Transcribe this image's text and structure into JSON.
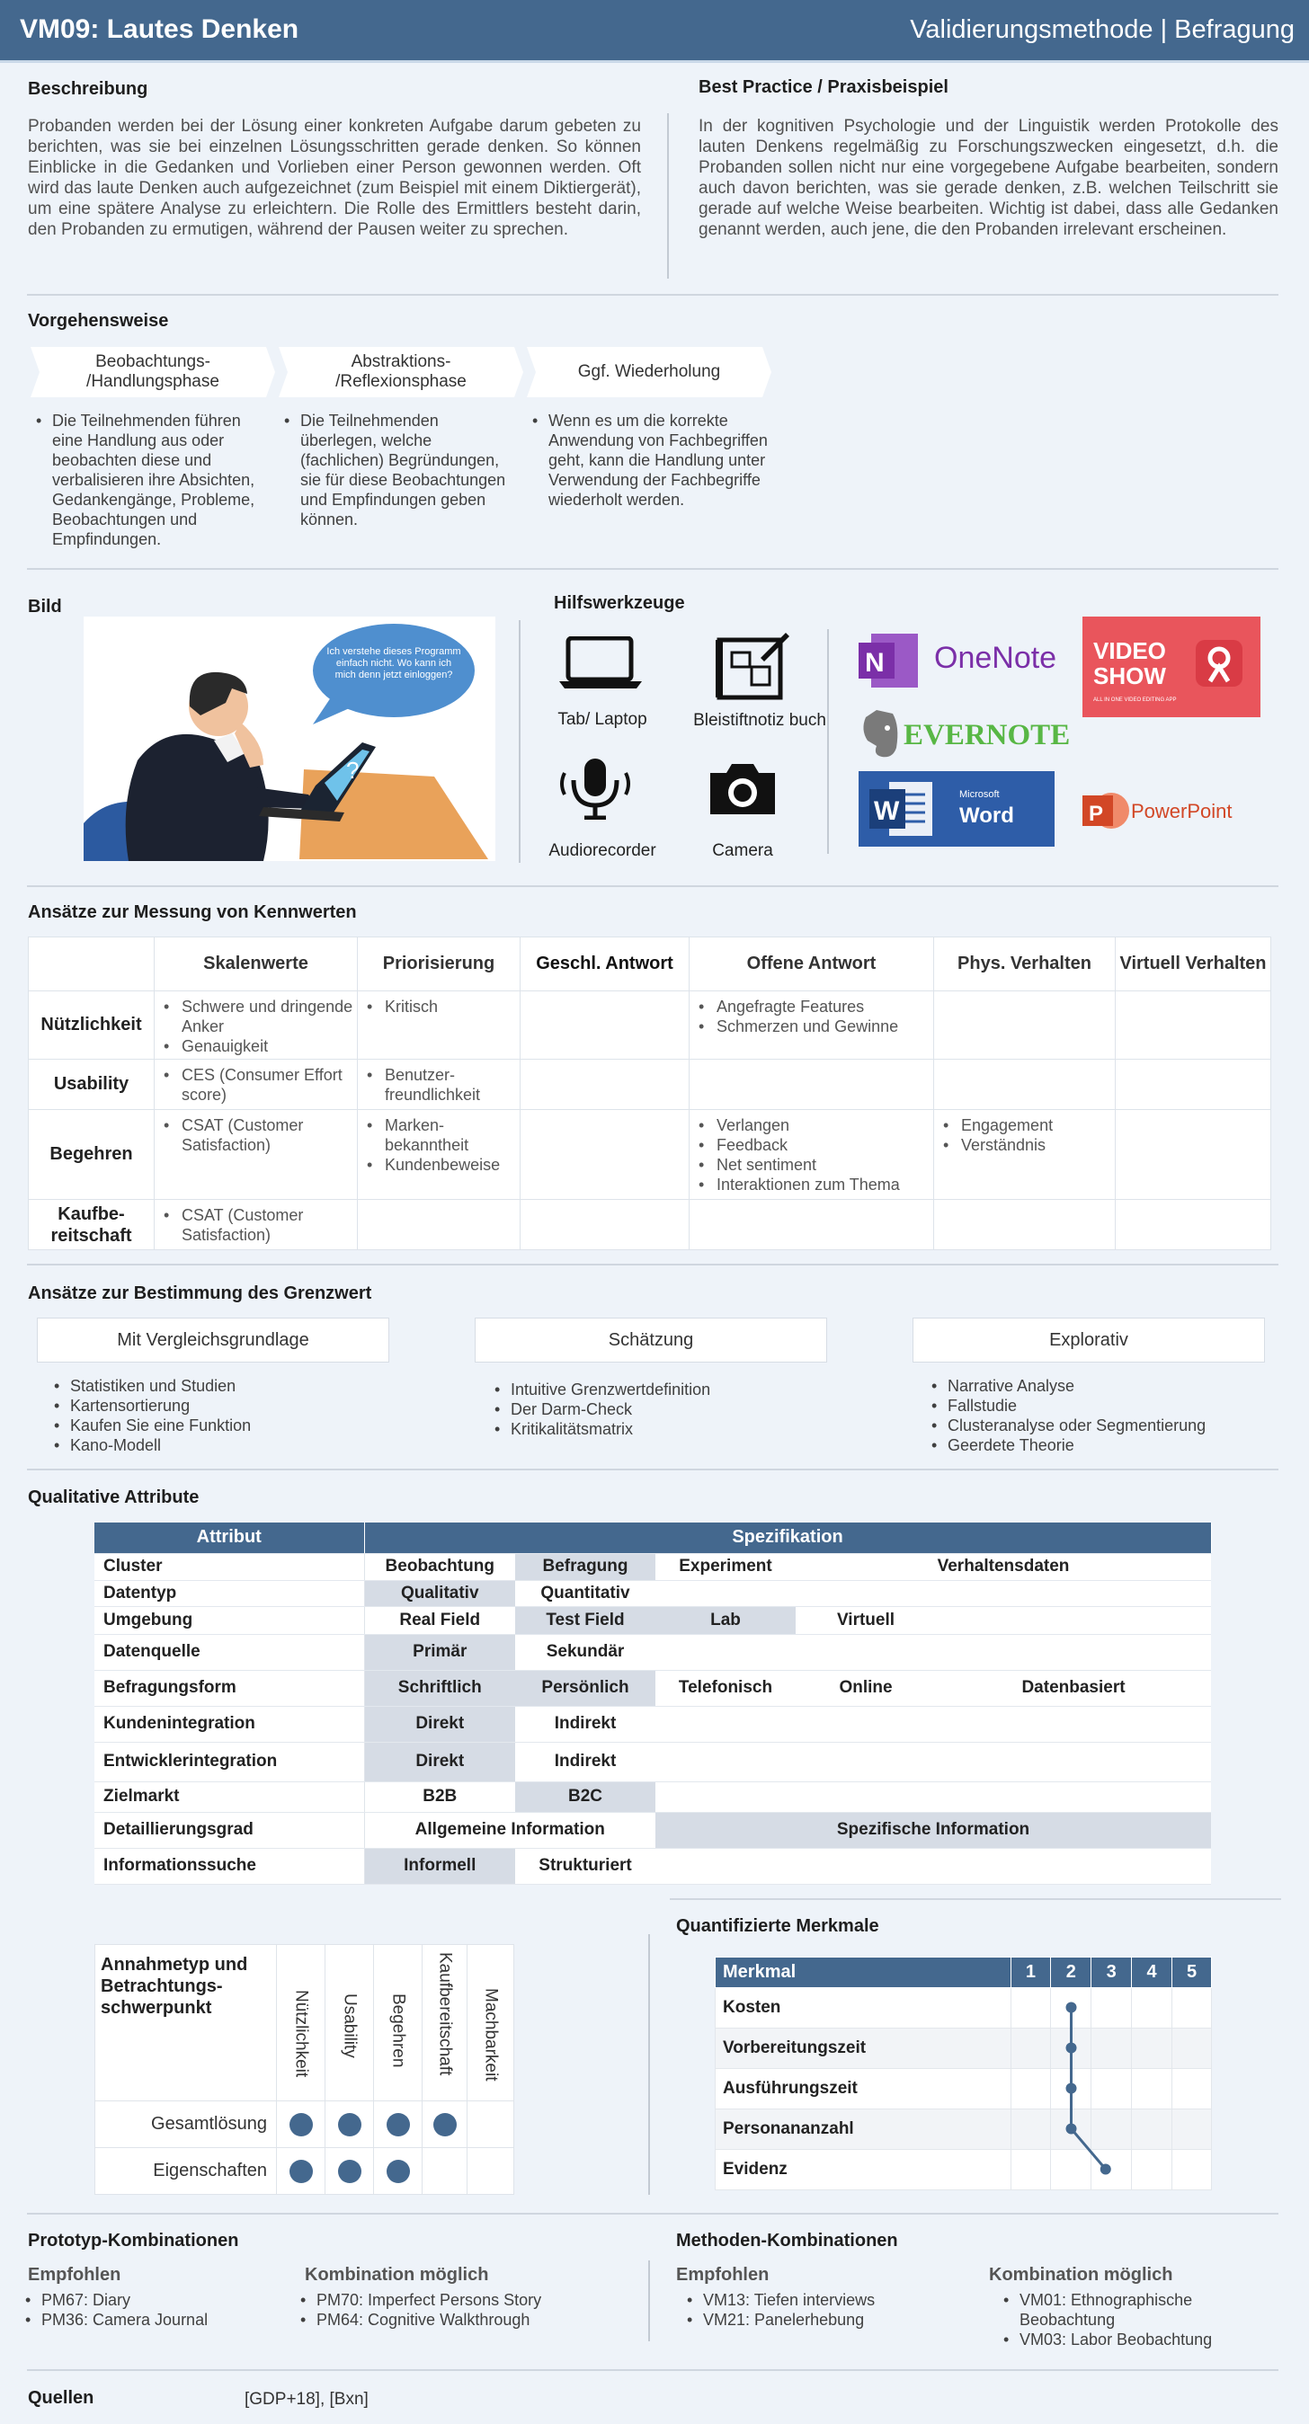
{
  "header": {
    "title": "VM09: Lautes Denken",
    "right": "Validierungsmethode | Befragung"
  },
  "beschreibung": {
    "title": "Beschreibung",
    "text": "Probanden werden bei der Lösung einer konkreten Aufgabe darum gebeten zu berichten, was sie bei einzelnen Lösungsschritten gerade denken. So können Einblicke in die Gedanken und Vorlieben einer Person gewonnen werden. Oft wird das laute Denken auch aufgezeichnet (zum Beispiel mit einem Diktiergerät), um eine spätere Analyse zu erleichtern. Die Rolle des Ermittlers besteht darin, den Probanden zu ermutigen, während der Pausen weiter zu sprechen."
  },
  "best_practice": {
    "title": "Best Practice / Praxisbeispiel",
    "text": "In der kognitiven Psychologie und der Linguistik werden Protokolle des lauten Denkens regelmäßig zu Forschungszwecken eingesetzt, d.h. die Probanden sollen nicht nur eine vorgegebene Aufgabe bearbeiten, sondern auch davon berichten, was sie gerade denken, z.B. welchen Teilschritt sie gerade auf welche Weise bearbeiten. Wichtig ist dabei, dass alle Gedanken genannt werden, auch jene, die den Probanden irrelevant erscheinen."
  },
  "vorgehensweise": {
    "title": "Vorgehensweise",
    "steps": [
      {
        "label": "Beobachtungs- /Handlungsphase",
        "text": "Die Teilnehmenden führen eine Handlung aus oder beobachten diese und verbalisieren ihre Absichten, Gedankengänge, Probleme, Beobachtungen und Empfindungen."
      },
      {
        "label": "Abstraktions- /Reflexionsphase",
        "text": "Die Teilnehmenden überlegen, welche (fachlichen) Begründungen, sie für diese Beobachtungen und Empfindungen geben können."
      },
      {
        "label": "Ggf. Wiederholung",
        "text": "Wenn es um die korrekte Anwendung von Fachbegriffen geht, kann die Handlung unter Verwendung der Fachbegriffe wiederholt werden."
      }
    ]
  },
  "bild": {
    "title": "Bild",
    "bubble": "Ich verstehe dieses Programm einfach nicht. Wo kann ich mich denn jetzt einloggen?"
  },
  "hilfswerkzeuge": {
    "title": "Hilfswerkzeuge",
    "tools": [
      {
        "label": "Tab/ Laptop",
        "icon": "laptop-icon"
      },
      {
        "label": "Bleistiftnotiz buch",
        "icon": "sketchbook-icon"
      },
      {
        "label": "Audiorecorder",
        "icon": "microphone-icon"
      },
      {
        "label": "Camera",
        "icon": "camera-icon"
      }
    ],
    "logos": {
      "onenote": "OneNote",
      "evernote": "EVERNOTE",
      "videoshow": "VIDEO SHOW",
      "videoshow_sub": "ALL IN ONE VIDEO EDITING APP",
      "word_ms": "Microsoft",
      "word": "Word",
      "powerpoint": "PowerPoint"
    }
  },
  "kennwerte": {
    "title": "Ansätze zur Messung von Kennwerten",
    "columns": [
      "Skalenwerte",
      "Priorisierung",
      "Geschl. Antwort",
      "Offene Antwort",
      "Phys. Verhalten",
      "Virtuell Verhalten"
    ],
    "rows": [
      {
        "label": "Nützlichkeit",
        "cells": [
          [
            "Schwere und dringende Anker",
            "Genauigkeit"
          ],
          [
            "Kritisch"
          ],
          [],
          [
            "Angefragte Features",
            "Schmerzen und Gewinne"
          ],
          [],
          []
        ]
      },
      {
        "label": "Usability",
        "cells": [
          [
            "CES (Consumer Effort score)"
          ],
          [
            "Benutzer-freundlichkeit"
          ],
          [],
          [],
          [],
          []
        ]
      },
      {
        "label": "Begehren",
        "cells": [
          [
            "CSAT (Customer Satisfaction)"
          ],
          [
            "Marken-bekanntheit",
            "Kundenbeweise"
          ],
          [],
          [
            "Verlangen",
            "Feedback",
            "Net sentiment",
            "Interaktionen zum Thema"
          ],
          [
            "Engagement",
            "Verständnis"
          ],
          []
        ]
      },
      {
        "label": "Kaufbe-reitschaft",
        "cells": [
          [
            "CSAT (Customer Satisfaction)"
          ],
          [],
          [],
          [],
          [],
          []
        ]
      }
    ]
  },
  "grenzwert": {
    "title": "Ansätze zur Bestimmung des Grenzwert",
    "groups": [
      {
        "label": "Mit Vergleichsgrundlage",
        "items": [
          "Statistiken und Studien",
          "Kartensortierung",
          "Kaufen Sie eine Funktion",
          "Kano-Modell"
        ]
      },
      {
        "label": "Schätzung",
        "items": [
          "Intuitive Grenzwertdefinition",
          "Der Darm-Check",
          "Kritikalitätsmatrix"
        ]
      },
      {
        "label": "Explorativ",
        "items": [
          "Narrative Analyse",
          "Fallstudie",
          "Clusteranalyse oder Segmentierung",
          "Geerdete Theorie"
        ]
      }
    ]
  },
  "qualitative": {
    "title": "Qualitative Attribute",
    "head_attr": "Attribut",
    "head_spec": "Spezifikation",
    "rows": [
      {
        "label": "Cluster",
        "cells": [
          "Beobachtung",
          "Befragung",
          "Experiment",
          "Verhaltensdaten"
        ]
      },
      {
        "label": "Datentyp",
        "cells": [
          "Qualitativ",
          "Quantitativ"
        ]
      },
      {
        "label": "Umgebung",
        "cells": [
          "Real Field",
          "Test Field",
          "Lab",
          "Virtuell"
        ]
      },
      {
        "label": "Datenquelle",
        "cells": [
          "Primär",
          "Sekundär"
        ]
      },
      {
        "label": "Befragungsform",
        "cells": [
          "Schriftlich",
          "Persönlich",
          "Telefonisch",
          "Online",
          "Datenbasiert"
        ]
      },
      {
        "label": "Kundenintegration",
        "cells": [
          "Direkt",
          "Indirekt"
        ]
      },
      {
        "label": "Entwicklerintegration",
        "cells": [
          "Direkt",
          "Indirekt"
        ]
      },
      {
        "label": "Zielmarkt",
        "cells": [
          "B2B",
          "B2C"
        ]
      },
      {
        "label": "Detaillierungsgrad",
        "cells": [
          "Allgemeine Information",
          "Spezifische Information"
        ]
      },
      {
        "label": "Informationssuche",
        "cells": [
          "Informell",
          "Strukturiert"
        ]
      }
    ]
  },
  "annahme": {
    "corner": "Annahmetyp und Betrachtungs-schwerpunkt",
    "columns": [
      "Nützlichkeit",
      "Usability",
      "Begehren",
      "Kaufbereitschaft",
      "Machbarkeit"
    ],
    "rows": [
      {
        "label": "Gesamtlösung",
        "dots": [
          true,
          true,
          true,
          true,
          false
        ]
      },
      {
        "label": "Eigenschaften",
        "dots": [
          true,
          true,
          true,
          false,
          false
        ]
      }
    ]
  },
  "quantifiziert": {
    "title": "Quantifizierte Merkmale",
    "head": "Merkmal",
    "scale": [
      "1",
      "2",
      "3",
      "4",
      "5"
    ],
    "rows": [
      {
        "label": "Kosten",
        "value": 2
      },
      {
        "label": "Vorbereitungszeit",
        "value": 2
      },
      {
        "label": "Ausführungszeit",
        "value": 2
      },
      {
        "label": "Personananzahl",
        "value": 2
      },
      {
        "label": "Evidenz",
        "value": 2.85
      }
    ]
  },
  "prototyp": {
    "title": "Prototyp-Kombinationen",
    "empfohlen_label": "Empfohlen",
    "empfohlen": [
      "PM67: Diary",
      "PM36: Camera Journal"
    ],
    "moeglich_label": "Kombination möglich",
    "moeglich": [
      "PM70: Imperfect Persons Story",
      "PM64: Cognitive Walkthrough"
    ]
  },
  "methoden": {
    "title": "Methoden-Kombinationen",
    "empfohlen_label": "Empfohlen",
    "empfohlen": [
      "VM13: Tiefen interviews",
      "VM21: Panelerhebung"
    ],
    "moeglich_label": "Kombination möglich",
    "moeglich": [
      "VM01: Ethnographische Beobachtung",
      "VM03: Labor Beobachtung"
    ]
  },
  "quellen": {
    "title": "Quellen",
    "text": "[GDP+18], [Bxn]"
  },
  "colors": {
    "header": "#44688e",
    "accent": "#44688e",
    "gray_cell": "#d6dce5"
  }
}
